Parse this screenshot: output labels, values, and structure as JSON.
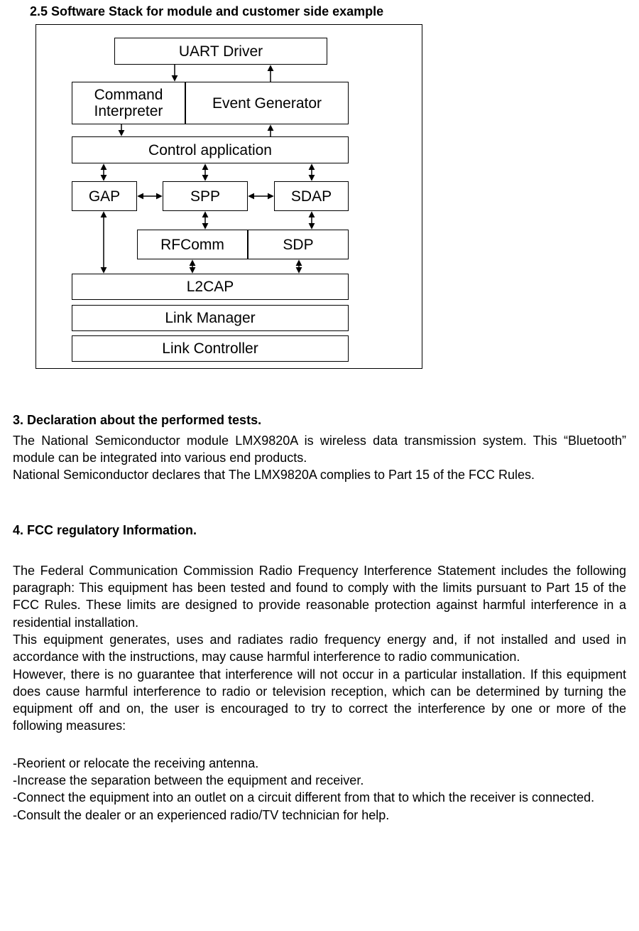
{
  "headings": {
    "h25": "2.5 Software Stack for module and customer side example",
    "h3": "3.  Declaration about the performed tests.",
    "h4": "4. FCC regulatory Information."
  },
  "diagram": {
    "uart": "UART Driver",
    "cmdInterp": "Command Interpreter",
    "evtGen": "Event Generator",
    "ctrlApp": "Control application",
    "gap": "GAP",
    "spp": "SPP",
    "sdap": "SDAP",
    "rfcomm": "RFComm",
    "sdp": "SDP",
    "l2cap": "L2CAP",
    "linkMgr": "Link Manager",
    "linkCtrl": "Link Controller"
  },
  "section3": {
    "p1": "The National Semiconductor module LMX9820A is wireless data transmission system. This “Bluetooth” module can be integrated into various end products.",
    "p2": "National Semiconductor declares that The LMX9820A complies to Part 15 of the FCC Rules."
  },
  "section4": {
    "p1": "The Federal Communication Commission Radio Frequency Interference Statement includes the following paragraph:  This equipment has been tested and found to comply with the limits pursuant to Part 15 of the FCC Rules. These limits are designed to provide reasonable protection against harmful interference in a residential installation.",
    "p2": "This equipment generates, uses and radiates radio frequency energy and, if not installed and used in accordance with the instructions, may cause harmful interference to radio communication.",
    "p3": "However, there is no guarantee that interference will not occur in a particular installation. If this equipment does cause harmful interference to radio or television reception, which can be determined by turning the equipment off and on, the user is encouraged to try to correct the interference by one or more of the following measures:",
    "b1": "-Reorient or relocate the receiving antenna.",
    "b2": "-Increase the separation between the equipment and receiver.",
    "b3": "-Connect the equipment into an outlet on a circuit different from that to which the receiver is connected.",
    "b4": "-Consult the dealer or an experienced radio/TV technician for help."
  }
}
